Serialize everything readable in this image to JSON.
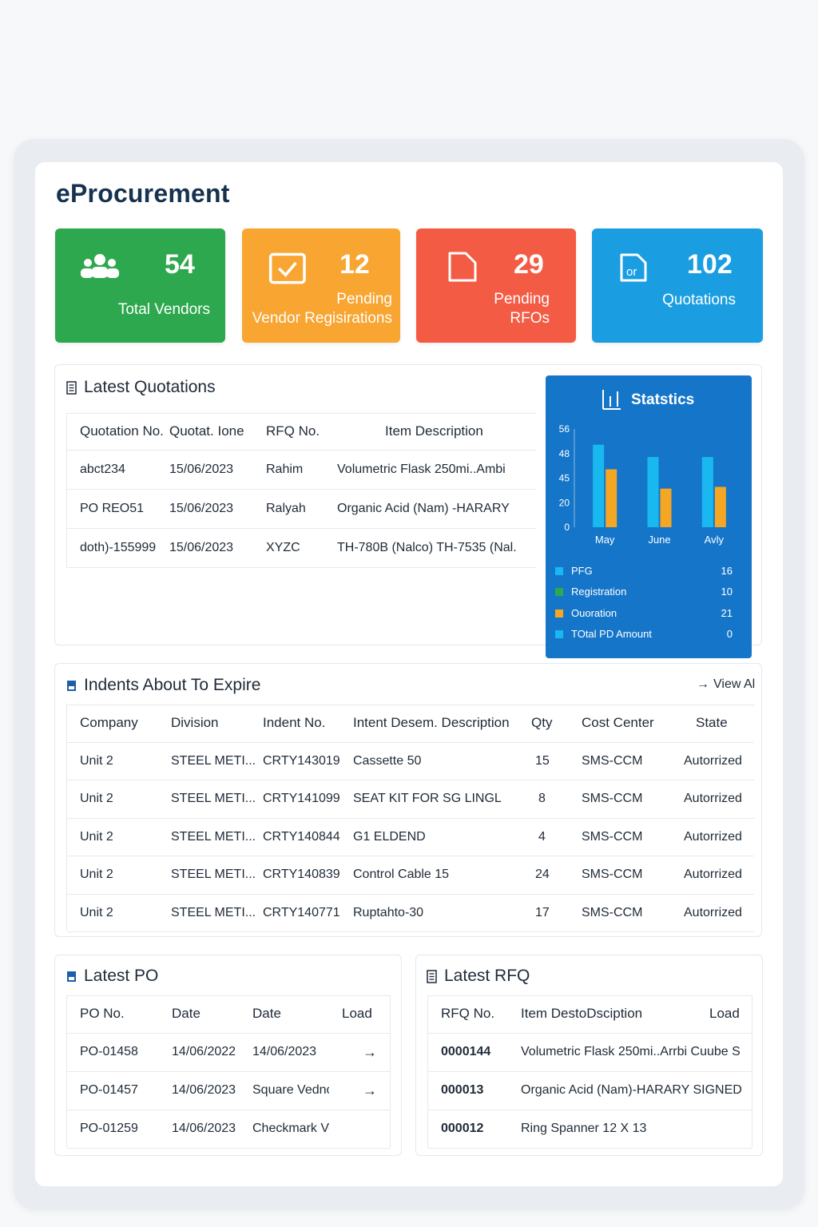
{
  "app": {
    "title": "eProcurement"
  },
  "cards": [
    {
      "value": "54",
      "label": "Total Vendors",
      "icon": "users-icon",
      "color": "#2ea84e"
    },
    {
      "value": "12",
      "label_line1": "Pending",
      "label_line2": "Vendor Regisirations",
      "icon": "check-square-icon",
      "color": "#f8a532"
    },
    {
      "value": "29",
      "label_line1": "Pending",
      "label_line2": "RFOs",
      "icon": "document-icon",
      "color": "#f45b44"
    },
    {
      "value": "102",
      "label": "Quotations",
      "icon": "quotation-file-icon",
      "color": "#1a9ee1"
    }
  ],
  "latest_quotations": {
    "title": "Latest Quotations",
    "headers": [
      "Quotation No.",
      "Quotat. Ione",
      "RFQ No.",
      "Item Description"
    ],
    "rows": [
      [
        "abct234",
        "15/06/2023",
        "Rahim",
        "Volumetric Flask 250mi..Ambi"
      ],
      [
        "PO REO51",
        "15/06/2023",
        "Ralyah",
        "Organic Acid (Nam) -HARARY"
      ],
      [
        "doth)-155999",
        "15/06/2023",
        "XYZC",
        "TH-780B (Nalco) TH-7535 (Nal."
      ]
    ]
  },
  "statistics": {
    "title": "Statstics",
    "legend": [
      {
        "name": "PFG",
        "value": "16",
        "color": "#1ab8f0"
      },
      {
        "name": "Registration",
        "value": "10",
        "color": "#2ea84e"
      },
      {
        "name": "Ouoration",
        "value": "21",
        "color": "#f5a623"
      },
      {
        "name": "TOtal PD Amount",
        "value": "0",
        "color": "#1ab8f0"
      }
    ]
  },
  "chart_data": {
    "type": "bar",
    "title": "Statstics",
    "categories": [
      "May",
      "June",
      "Avly"
    ],
    "series": [
      {
        "values": [
          47,
          40,
          40
        ],
        "color": "#1ab8f0"
      },
      {
        "values": [
          33,
          22,
          23
        ],
        "color": "#f5a623"
      }
    ],
    "yticks": [
      "0",
      "20",
      "45",
      "48",
      "56"
    ],
    "ylim": [
      0,
      56
    ],
    "grid": false,
    "legend_position": "bottom"
  },
  "indents": {
    "title": "Indents About To Expire",
    "view_all": "View Al",
    "headers": [
      "Company",
      "Division",
      "Indent No.",
      "Intent Desem. Description",
      "Qty",
      "Cost Center",
      "State"
    ],
    "rows": [
      [
        "Unit 2",
        "STEEL METI...",
        "CRTY143019",
        "Cassette 50",
        "15",
        "SMS-CCM",
        "Autorrized"
      ],
      [
        "Unit 2",
        "STEEL METI...",
        "CRTY141099",
        "SEAT KIT FOR SG LINGL",
        "8",
        "SMS-CCM",
        "Autorrized"
      ],
      [
        "Unit 2",
        "STEEL METI...",
        "CRTY140844",
        "G1 ELDEND",
        "4",
        "SMS-CCM",
        "Autorrized"
      ],
      [
        "Unit 2",
        "STEEL METI...",
        "CRTY140839",
        "Control Cable 15",
        "24",
        "SMS-CCM",
        "Autorrized"
      ],
      [
        "Unit 2",
        "STEEL METI...",
        "CRTY140771",
        "Ruptahto-30",
        "17",
        "SMS-CCM",
        "Autorrized"
      ]
    ]
  },
  "latest_po": {
    "title": "Latest PO",
    "headers": [
      "PO No.",
      "Date",
      "Date",
      "Load"
    ],
    "rows": [
      [
        "PO-01458",
        "14/06/2022",
        "14/06/2023",
        "→"
      ],
      [
        "PO-01457",
        "14/06/2023",
        "Square Vednor",
        "→"
      ],
      [
        "PO-01259",
        "14/06/2023",
        "Checkmark Vendor",
        ""
      ]
    ]
  },
  "latest_rfq": {
    "title": "Latest RFQ",
    "headers": [
      "RFQ No.",
      "Item DestoDsciption",
      "Load"
    ],
    "rows": [
      [
        "0000144",
        "Volumetric Flask 250mi..Arrbi Cuube S"
      ],
      [
        "000013",
        "Organic Acid (Nam)-HARARY SIGNED"
      ],
      [
        "000012",
        "Ring Spanner 12 X 13"
      ]
    ]
  }
}
